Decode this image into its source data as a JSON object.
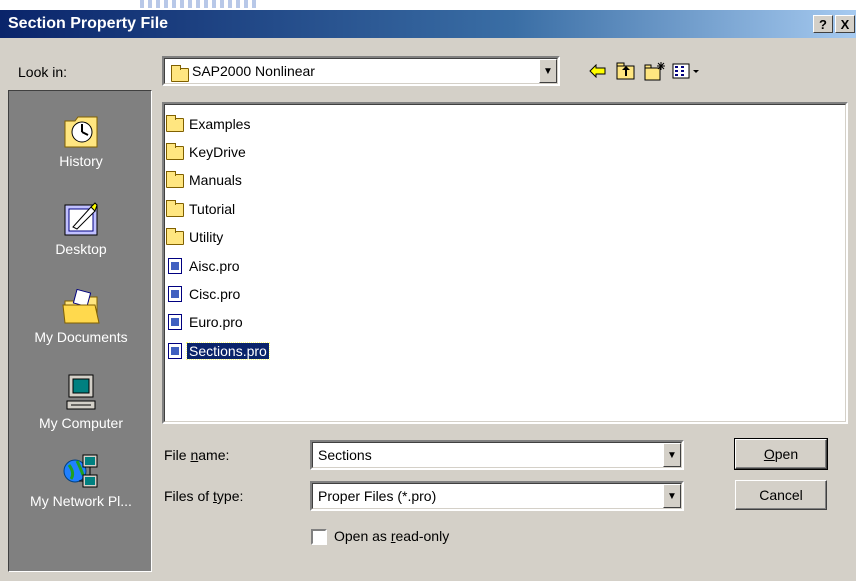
{
  "window": {
    "title": "Section Property File",
    "help_button": "?",
    "close_button": "X"
  },
  "lookin": {
    "label": "Look in:",
    "value": "SAP2000 Nonlinear"
  },
  "toolbar": {
    "icons": [
      "back-icon",
      "up-folder-icon",
      "new-folder-icon",
      "views-menu-icon"
    ]
  },
  "places": [
    {
      "label": "History",
      "icon": "history-icon"
    },
    {
      "label": "Desktop",
      "icon": "desktop-icon"
    },
    {
      "label": "My Documents",
      "icon": "my-documents-icon"
    },
    {
      "label": "My Computer",
      "icon": "my-computer-icon"
    },
    {
      "label": "My Network Pl...",
      "icon": "network-places-icon"
    }
  ],
  "files": [
    {
      "name": "Examples",
      "type": "folder"
    },
    {
      "name": "KeyDrive",
      "type": "folder"
    },
    {
      "name": "Manuals",
      "type": "folder"
    },
    {
      "name": "Tutorial",
      "type": "folder"
    },
    {
      "name": "Utility",
      "type": "folder"
    },
    {
      "name": "Aisc.pro",
      "type": "file"
    },
    {
      "name": "Cisc.pro",
      "type": "file"
    },
    {
      "name": "Euro.pro",
      "type": "file"
    },
    {
      "name": "Sections.pro",
      "type": "file",
      "selected": true
    }
  ],
  "filename": {
    "label": "File name:",
    "value": "Sections"
  },
  "filetype": {
    "label": "Files of type:",
    "value": "Proper Files (*.pro)"
  },
  "buttons": {
    "open": "Open",
    "cancel": "Cancel"
  },
  "readonly": {
    "label": "Open as read-only",
    "checked": false
  },
  "colors": {
    "titlebar": "#0a246a",
    "selection": "#0a246a",
    "face": "#d4d0c8",
    "places_bar": "#808080"
  }
}
